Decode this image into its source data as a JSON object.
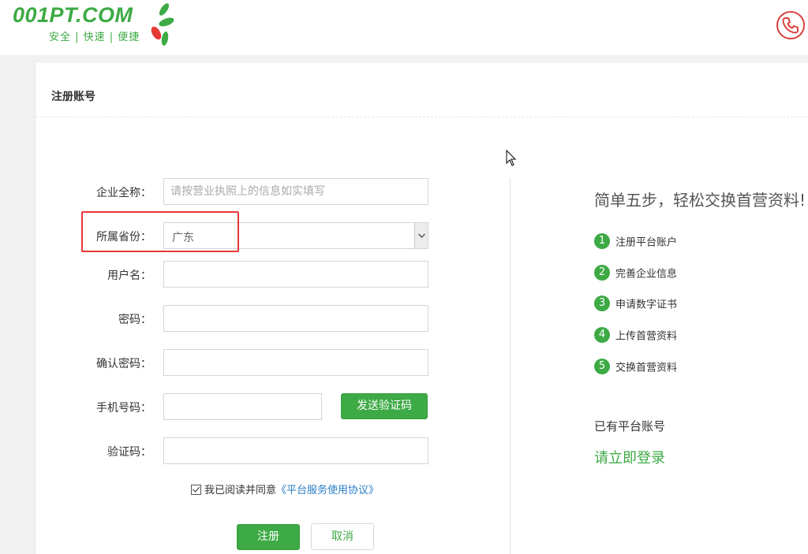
{
  "header": {
    "logo_text": "001PT.COM",
    "slogan": "安全 | 快速 | 便捷",
    "brand_color": "#3daa45",
    "phone_icon": "phone-icon"
  },
  "page": {
    "title": "注册账号"
  },
  "form": {
    "company": {
      "label": "企业全称：",
      "placeholder": "请按营业执照上的信息如实填写",
      "value": ""
    },
    "province": {
      "label": "所属省份：",
      "value": "广东"
    },
    "username": {
      "label": "用户名：",
      "value": ""
    },
    "password": {
      "label": "密码：",
      "value": ""
    },
    "confirm_password": {
      "label": "确认密码：",
      "value": ""
    },
    "phone": {
      "label": "手机号码：",
      "value": ""
    },
    "send_code_label": "发送验证码",
    "code": {
      "label": "验证码：",
      "value": ""
    },
    "agree_text": "我已阅读并同意",
    "agree_link": "《平台服务使用协议》",
    "agree_checked": true,
    "submit_label": "注册",
    "cancel_label": "取消"
  },
  "steps": {
    "title": "简单五步，轻松交换首营资料!",
    "items": [
      {
        "num": "1",
        "label": "注册平台账户"
      },
      {
        "num": "2",
        "label": "完善企业信息"
      },
      {
        "num": "3",
        "label": "申请数字证书"
      },
      {
        "num": "4",
        "label": "上传首营资料"
      },
      {
        "num": "5",
        "label": "交换首营资料"
      }
    ],
    "have_account": "已有平台账号",
    "login_link": "请立即登录"
  },
  "colors": {
    "accent": "#3daa45",
    "highlight": "#e53935",
    "link": "#2a7ec6"
  }
}
